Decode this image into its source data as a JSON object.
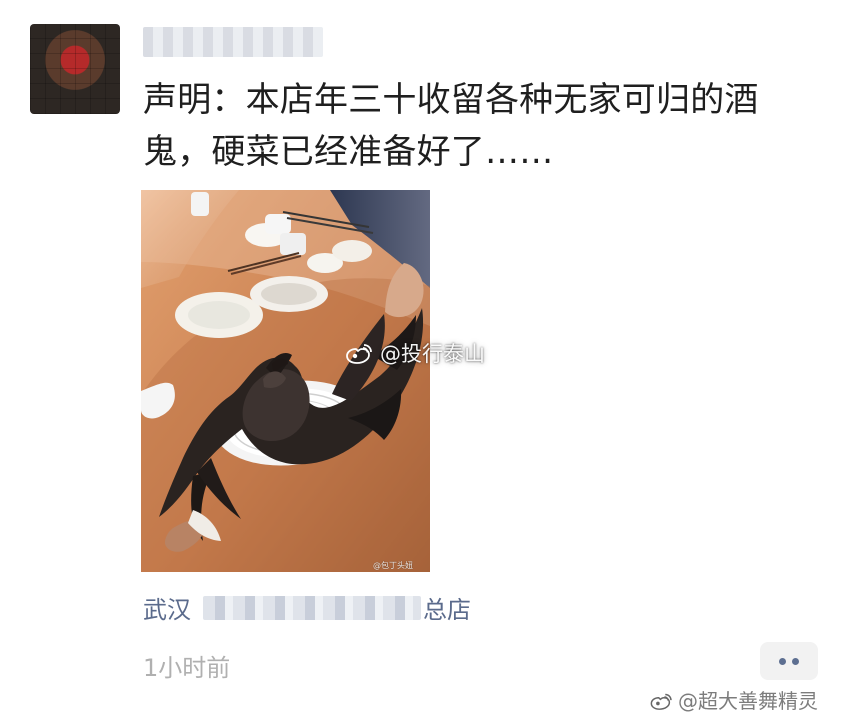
{
  "post": {
    "text": "声明：本店年三十收留各种无家可归的酒鬼，硬菜已经准备好了……",
    "location_prefix": "武汉",
    "location_suffix": "总店",
    "time": "1小时前"
  },
  "watermarks": {
    "center": "@投行泰山",
    "image_small": "@包丁头妞",
    "bottom": "@超大善舞精灵"
  },
  "colors": {
    "location": "#5b6b8c",
    "time": "#b0b0b0",
    "more_dots": "#5d6f91"
  },
  "icons": {
    "avatar": "avatar-icon",
    "weibo": "weibo-icon",
    "more": "more-options-icon"
  }
}
